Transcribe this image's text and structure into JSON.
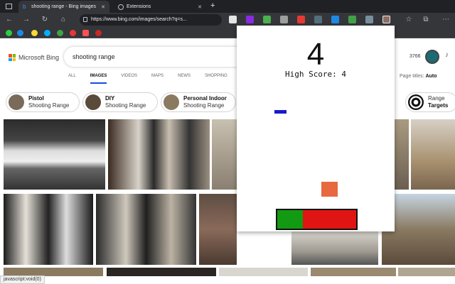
{
  "browser": {
    "tabs": [
      {
        "title": "shooting range - Bing images",
        "close": "✕"
      },
      {
        "title": "Extensions",
        "close": "✕"
      }
    ],
    "new_tab": "+",
    "url": "https://www.bing.com/images/search?q=s..."
  },
  "bing": {
    "logo_text": "Microsoft Bing",
    "query": "shooting range",
    "nav": [
      "ALL",
      "IMAGES",
      "VIDEOS",
      "MAPS",
      "NEWS",
      "SHOPPING"
    ],
    "selected_nav": "IMAGES",
    "points": "3766",
    "page_titles_label": "Page titles:",
    "page_titles_value": "Auto",
    "chips": [
      {
        "line1": "Pistol",
        "line2": "Shooting Range"
      },
      {
        "line1": "DIY",
        "line2": "Shooting Range"
      },
      {
        "line1": "Personal Indoor",
        "line2": "Shooting Range"
      },
      {
        "line1": "Range",
        "line2": "Targets"
      }
    ]
  },
  "game": {
    "score": "4",
    "high_score_text": "High Score: 4",
    "health_fraction": 0.32,
    "colors": {
      "paddle": "#1a1acc",
      "block": "#e8683f",
      "health": "#129a12",
      "damage": "#e11414"
    }
  },
  "status_text": "javascript:void(0)"
}
